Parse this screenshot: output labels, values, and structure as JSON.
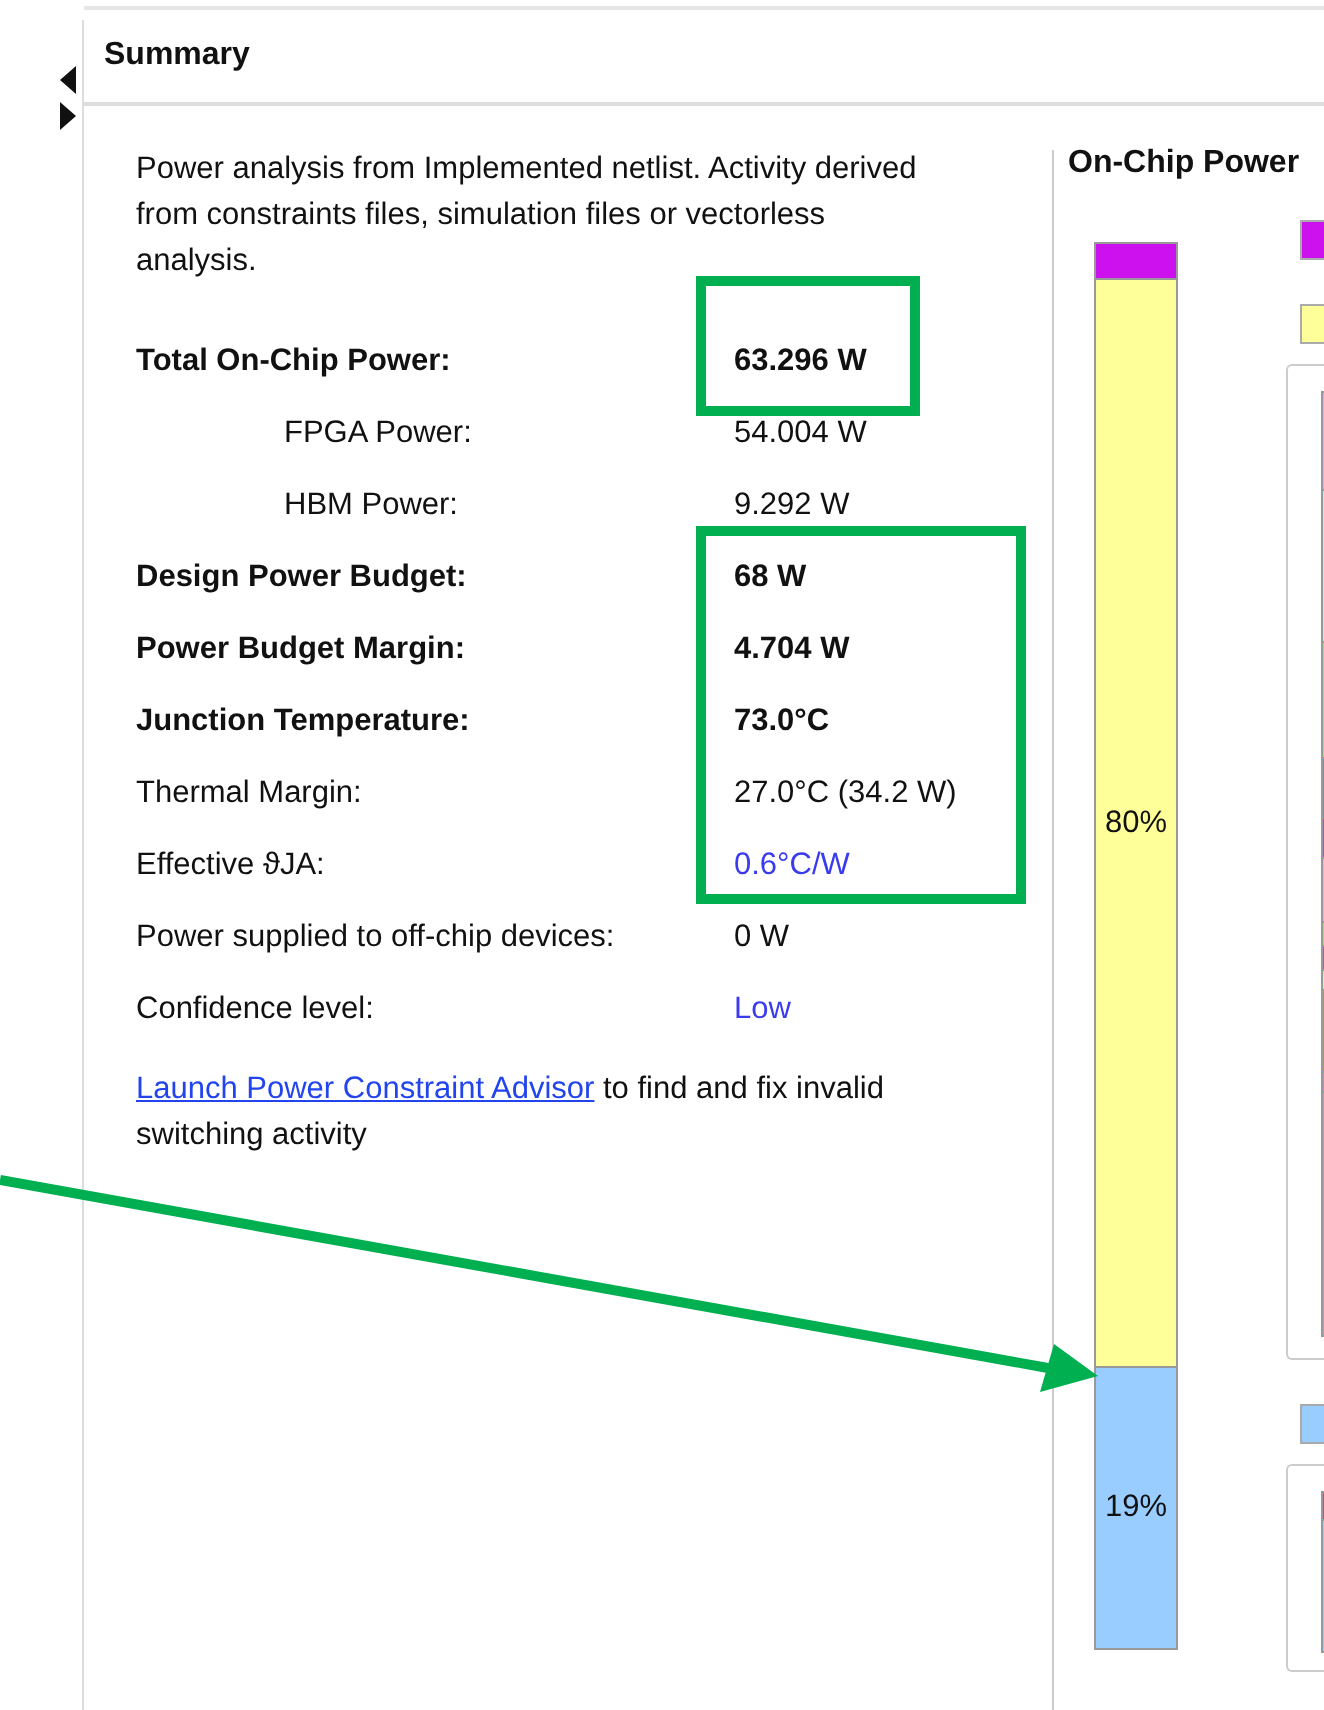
{
  "header": {
    "title": "Summary"
  },
  "description": "Power analysis from Implemented netlist. Activity derived from constraints files, simulation files or vectorless analysis.",
  "rows": [
    {
      "label": "Total On-Chip Power:",
      "value": "63.296 W",
      "bold": true,
      "indented": false,
      "highlighted": false
    },
    {
      "label": "FPGA Power:",
      "value": "54.004 W",
      "bold": false,
      "indented": true,
      "highlighted": false
    },
    {
      "label": "HBM Power:",
      "value": "9.292 W",
      "bold": false,
      "indented": true,
      "highlighted": false
    },
    {
      "label": "Design Power Budget:",
      "value": "68 W",
      "bold": true,
      "indented": false,
      "highlighted": false
    },
    {
      "label": "Power Budget Margin:",
      "value": "4.704 W",
      "bold": true,
      "indented": false,
      "highlighted": false
    },
    {
      "label": "Junction Temperature:",
      "value": "73.0°C",
      "bold": true,
      "indented": false,
      "highlighted": false
    },
    {
      "label": "Thermal Margin:",
      "value": "27.0°C (34.2 W)",
      "bold": false,
      "indented": false,
      "highlighted": false
    },
    {
      "label": "Effective ϑJA:",
      "value": "0.6°C/W",
      "bold": false,
      "indented": false,
      "highlighted": true
    },
    {
      "label": "Power supplied to off-chip devices:",
      "value": "0 W",
      "bold": false,
      "indented": false,
      "highlighted": false
    },
    {
      "label": "Confidence level:",
      "value": "Low",
      "bold": false,
      "indented": false,
      "highlighted": true
    }
  ],
  "advisor": {
    "link": "Launch Power Constraint Advisor",
    "text": "to find and fix invalid switching activity"
  },
  "chart": {
    "title": "On-Chip Power",
    "segments": [
      {
        "color": "#cc11ee"
      },
      {
        "color": "#ffff99",
        "label": "80%"
      },
      {
        "color": "#99ccff",
        "label": "19%"
      }
    ]
  },
  "annotations": [
    {
      "kind": "box",
      "color": "#00b050"
    },
    {
      "kind": "box",
      "color": "#00b050"
    },
    {
      "kind": "arrow",
      "color": "#00b050"
    }
  ]
}
